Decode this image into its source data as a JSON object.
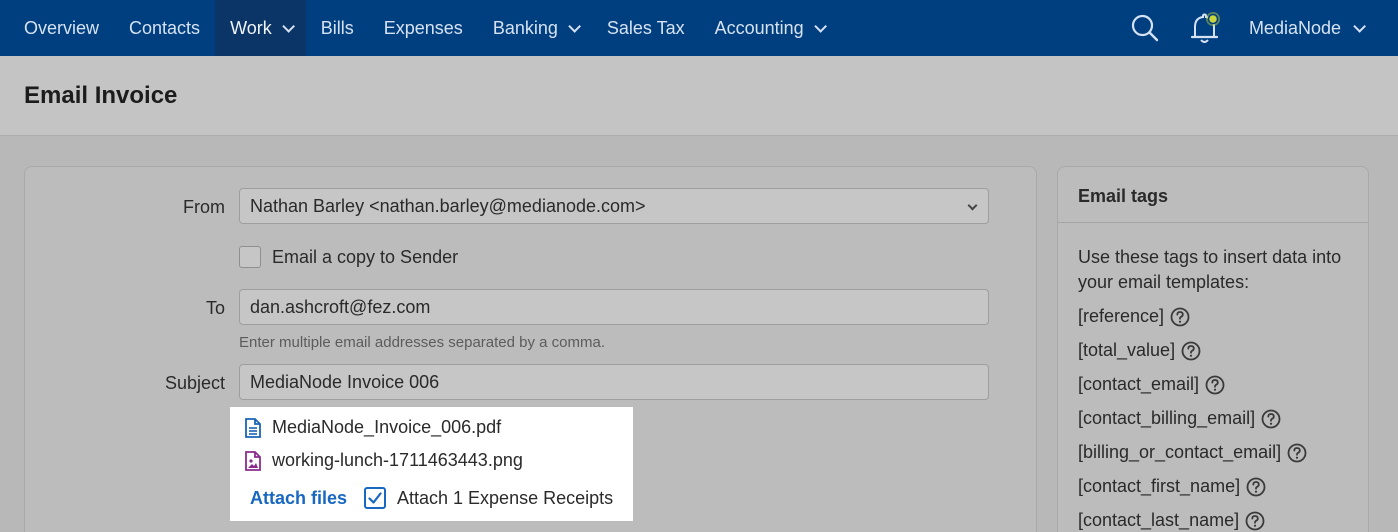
{
  "nav": {
    "items": [
      {
        "label": "Overview",
        "dropdown": false,
        "active": false
      },
      {
        "label": "Contacts",
        "dropdown": false,
        "active": false
      },
      {
        "label": "Work",
        "dropdown": true,
        "active": true
      },
      {
        "label": "Bills",
        "dropdown": false,
        "active": false
      },
      {
        "label": "Expenses",
        "dropdown": false,
        "active": false
      },
      {
        "label": "Banking",
        "dropdown": true,
        "active": false
      },
      {
        "label": "Sales Tax",
        "dropdown": false,
        "active": false
      },
      {
        "label": "Accounting",
        "dropdown": true,
        "active": false
      }
    ],
    "search_icon": "search-icon",
    "notification_icon": "bell-icon",
    "account_label": "MediaNode"
  },
  "page": {
    "title": "Email Invoice"
  },
  "form": {
    "from_label": "From",
    "from_value": "Nathan Barley <nathan.barley@medianode.com>",
    "copy_label": "Email a copy to Sender",
    "copy_checked": false,
    "to_label": "To",
    "to_value": "dan.ashcroft@fez.com",
    "to_hint": "Enter multiple email addresses separated by a comma.",
    "subject_label": "Subject",
    "subject_value": "MediaNode Invoice 006"
  },
  "attachments": {
    "files": [
      {
        "name": "MediaNode_Invoice_006.pdf",
        "icon": "document-icon"
      },
      {
        "name": "working-lunch-1711463443.png",
        "icon": "image-file-icon"
      }
    ],
    "attach_link": "Attach files",
    "receipts_label": "Attach 1 Expense Receipts",
    "receipts_checked": true
  },
  "email_tags": {
    "title": "Email tags",
    "description": "Use these tags to insert data into your email templates:",
    "tags": [
      "[reference]",
      "[total_value]",
      "[contact_email]",
      "[contact_billing_email]",
      "[billing_or_contact_email]",
      "[contact_first_name]",
      "[contact_last_name]"
    ]
  },
  "colors": {
    "nav_bg": "#003f7f",
    "link": "#1868c0",
    "pdf_icon": "#1a66b5",
    "image_icon": "#8a2b8e",
    "bell_dot": "#c7d63c"
  }
}
